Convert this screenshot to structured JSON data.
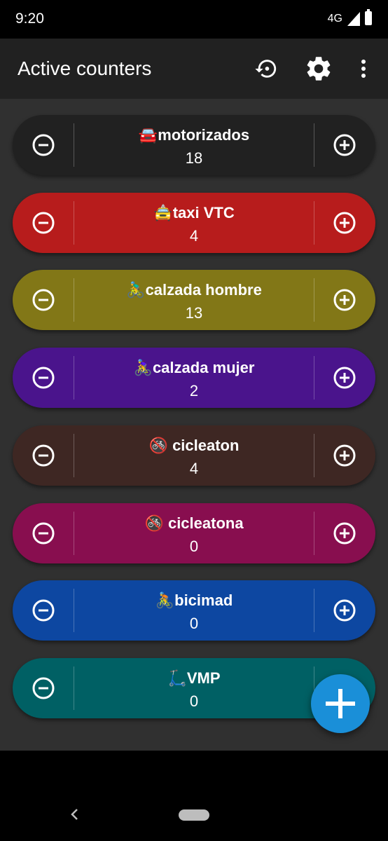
{
  "status_bar": {
    "time": "9:20",
    "network": "4G",
    "icons": [
      "signal-icon",
      "battery-icon"
    ]
  },
  "app_bar": {
    "title": "Active counters",
    "actions": [
      "reset-icon",
      "settings-icon",
      "overflow-menu-icon"
    ]
  },
  "counters": [
    {
      "emoji": "🚘",
      "label": "motorizados",
      "count": "18",
      "color": "#212121"
    },
    {
      "emoji": "🚖",
      "label": "taxi VTC",
      "count": "4",
      "color": "#b71c1c"
    },
    {
      "emoji": "🚴‍♂️",
      "label": "calzada hombre",
      "count": "13",
      "color": "#827717"
    },
    {
      "emoji": "🚴‍♀️",
      "label": "calzada mujer",
      "count": "2",
      "color": "#4a148c"
    },
    {
      "emoji": "🚳",
      "label": " cicleaton",
      "count": "4",
      "color": "#3e2723"
    },
    {
      "emoji": "🚳",
      "label": " cicleatona",
      "count": "0",
      "color": "#880e4f"
    },
    {
      "emoji": "🚴",
      "label": "bicimad",
      "count": "0",
      "color": "#0d47a1"
    },
    {
      "emoji": "🛴",
      "label": "VMP",
      "count": "0",
      "color": "#006064"
    }
  ],
  "counter_icons": {
    "decrement": "minus-circle-icon",
    "increment": "plus-circle-icon"
  },
  "fab": {
    "icon": "add-icon",
    "color": "#1a8fd8"
  },
  "nav_bar": {
    "icons": [
      "back-icon",
      "home-pill"
    ]
  }
}
